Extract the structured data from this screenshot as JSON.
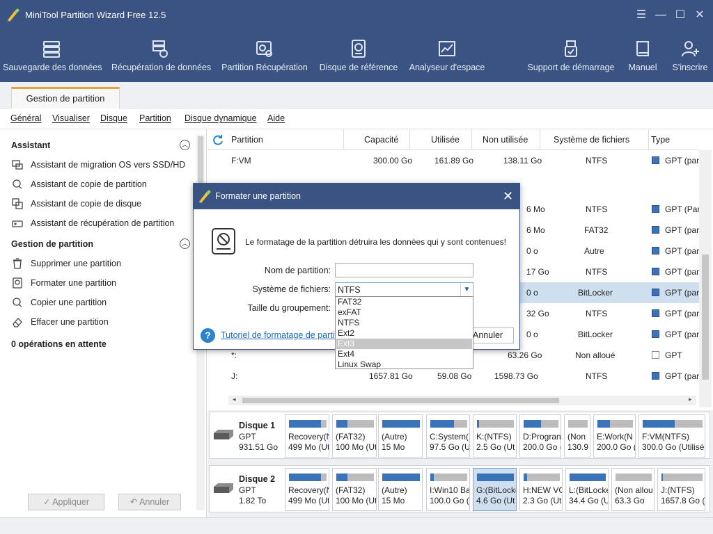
{
  "window": {
    "title": "MiniTool Partition Wizard Free 12.5"
  },
  "toolbar": [
    {
      "label": "Sauvegarde des données",
      "icon": "backup-icon"
    },
    {
      "label": "Récupération de données",
      "icon": "data-recovery-icon"
    },
    {
      "label": "Partition Récupération",
      "icon": "partition-recovery-icon"
    },
    {
      "label": "Disque de référence",
      "icon": "disk-benchmark-icon"
    },
    {
      "label": "Analyseur d'espace",
      "icon": "space-analyzer-icon"
    },
    {
      "label": "Support de démarrage",
      "icon": "bootable-media-icon"
    },
    {
      "label": "Manuel",
      "icon": "manual-icon"
    },
    {
      "label": "S'inscrire",
      "icon": "register-icon"
    }
  ],
  "tab": {
    "label": "Gestion de partition"
  },
  "menu": [
    "Général",
    "Visualiser",
    "Disque",
    "Partition",
    "Disque dynamique",
    "Aide"
  ],
  "sidebar": {
    "assistant_title": "Assistant",
    "assistant_items": [
      "Assistant de migration OS vers SSD/HD",
      "Assistant de copie de partition",
      "Assistant de copie de disque",
      "Assistant de récupération de partition"
    ],
    "manage_title": "Gestion de partition",
    "manage_items": [
      "Supprimer une partition",
      "Formater une partition",
      "Copier une partition",
      "Effacer une partition"
    ],
    "pending": "0 opérations en attente",
    "apply": "✓ Appliquer",
    "undo": "↶ Annuler"
  },
  "table": {
    "headers": [
      "Partition",
      "Capacité",
      "Utilisée",
      "Non utilisée",
      "Système de fichiers",
      "Type"
    ],
    "rows": [
      {
        "partition": "F:VM",
        "capacity": "300.00 Go",
        "used": "161.89 Go",
        "unused": "138.11 Go",
        "fs": "NTFS",
        "type": "GPT (par"
      },
      {
        "partition": "",
        "capacity": "",
        "used": "",
        "unused": "",
        "fs": "",
        "type": ""
      },
      {
        "partition": "",
        "capacity": "",
        "used": "",
        "unused": "6 Mo",
        "fs": "NTFS",
        "type": "GPT (Par"
      },
      {
        "partition": "",
        "capacity": "",
        "used": "",
        "unused": "6 Mo",
        "fs": "FAT32",
        "type": "GPT (par"
      },
      {
        "partition": "",
        "capacity": "",
        "used": "",
        "unused": "0 o",
        "fs": "Autre",
        "type": "GPT (par"
      },
      {
        "partition": "",
        "capacity": "",
        "used": "",
        "unused": "17 Go",
        "fs": "NTFS",
        "type": "GPT (par"
      },
      {
        "partition": "",
        "capacity": "",
        "used": "",
        "unused": "0 o",
        "fs": "BitLocker",
        "type": "GPT (par"
      },
      {
        "partition": "",
        "capacity": "",
        "used": "",
        "unused": "32 Go",
        "fs": "NTFS",
        "type": "GPT (par"
      },
      {
        "partition": "",
        "capacity": "",
        "used": "",
        "unused": "0 o",
        "fs": "BitLocker",
        "type": "GPT (par"
      },
      {
        "partition": "*:",
        "capacity": "",
        "used": "",
        "unused": "63.26 Go",
        "fs": "Non alloué",
        "type": "GPT"
      },
      {
        "partition": "J:",
        "capacity": "1657.81 Go",
        "used": "59.08 Go",
        "unused": "1598.73 Go",
        "fs": "NTFS",
        "type": "GPT (par"
      }
    ]
  },
  "disks": [
    {
      "name": "Disque 1",
      "type": "GPT",
      "size": "931.51 Go",
      "partitions": [
        {
          "line1": "Recovery(N",
          "line2": "499 Mo (Ut",
          "fill": 0.85
        },
        {
          "line1": "(FAT32)",
          "line2": "100 Mo (Ut",
          "fill": 0.3
        },
        {
          "line1": "(Autre)",
          "line2": "15 Mo",
          "fill": 1.0
        },
        {
          "line1": "C:System(N",
          "line2": "97.5 Go (Ut",
          "fill": 0.65
        },
        {
          "line1": "K:(NTFS)",
          "line2": "2.5 Go (Ut",
          "fill": 0.05
        },
        {
          "line1": "D:Progran",
          "line2": "200.0 Go (",
          "fill": 0.5
        },
        {
          "line1": "(Non",
          "line2": "130.9",
          "fill": 0.0
        },
        {
          "line1": "E:Work(N",
          "line2": "200.0 Go (",
          "fill": 0.35
        },
        {
          "line1": "F:VM(NTFS)",
          "line2": "300.0 Go (Utilisé",
          "fill": 0.54
        }
      ]
    },
    {
      "name": "Disque 2",
      "type": "GPT",
      "size": "1.82 To",
      "partitions": [
        {
          "line1": "Recovery(N",
          "line2": "499 Mo (Ut",
          "fill": 0.85
        },
        {
          "line1": "(FAT32)",
          "line2": "100 Mo (Ut",
          "fill": 0.3
        },
        {
          "line1": "(Autre)",
          "line2": "15 Mo",
          "fill": 1.0
        },
        {
          "line1": "I:Win10 Ba",
          "line2": "100.0 Go (",
          "fill": 0.1
        },
        {
          "line1": "G:(BitLocke",
          "line2": "4.6 Go (Ut",
          "fill": 1.0
        },
        {
          "line1": "H:NEW VO",
          "line2": "2.3 Go (Ut",
          "fill": 0.1
        },
        {
          "line1": "L:(BitLocke",
          "line2": "34.4 Go (Ut",
          "fill": 1.0
        },
        {
          "line1": "(Non allou",
          "line2": "63.3 Go",
          "fill": 0.0
        },
        {
          "line1": "J:(NTFS)",
          "line2": "1657.8 Go (",
          "fill": 0.04
        }
      ]
    }
  ],
  "dialog": {
    "title": "Formater une partition",
    "warning": "Le formatage de la partition détruira les données qui y sont contenues!",
    "label_name": "Nom de partition:",
    "label_fs": "Système de fichiers:",
    "label_cluster": "Taille du groupement:",
    "name_value": "",
    "fs_value": "NTFS",
    "help_link": "Tutoriel de formatage de partit",
    "cancel": "Annuler",
    "fs_options": [
      "FAT32",
      "exFAT",
      "NTFS",
      "Ext2",
      "Ext3",
      "Ext4",
      "Linux Swap"
    ],
    "fs_highlighted": "Ext3"
  }
}
